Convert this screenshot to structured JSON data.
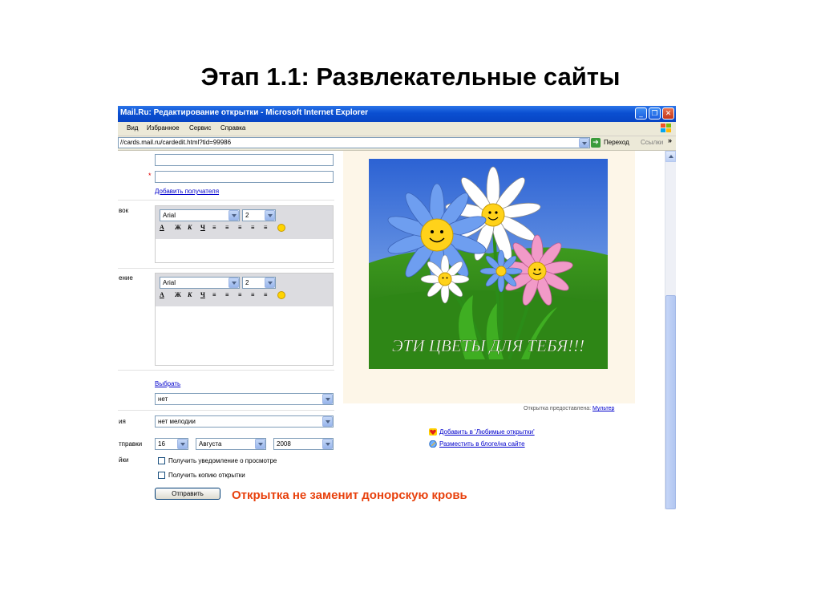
{
  "slide": {
    "title": "Этап 1.1: Развлекательные сайты",
    "caption": "Открытка не заменит донорскую кровь"
  },
  "window": {
    "title": "Mail.Ru: Редактирование открытки - Microsoft Internet Explorer",
    "menu": [
      "Вид",
      "Избранное",
      "Сервис",
      "Справка"
    ],
    "address": "//cards.mail.ru/cardedit.html?tid=99986",
    "go_label": "Переход",
    "links_label": "Ссылки",
    "chevron": "»"
  },
  "form": {
    "required_mark": "*",
    "add_recipient": "Добавить получателя",
    "editor1": {
      "label": "вок",
      "font": "Arial",
      "size": "2"
    },
    "editor2": {
      "label": "ение",
      "font": "Arial",
      "size": "2"
    },
    "toolbar_glyphs": [
      "A",
      "Ж",
      "К",
      "Ч",
      "≡",
      "≡",
      "≡",
      "≡",
      "≡"
    ],
    "choose_link": "Выбрать",
    "choose_value": "нет",
    "melody_label": "ия",
    "melody_value": "нет мелодии",
    "date_label": "тправки",
    "day": "16",
    "month": "Августа",
    "year": "2008",
    "settings_label": "йки",
    "notify_label": "Получить уведомление о просмотре",
    "copy_label": "Получить копию открытки",
    "send_button": "Отправить"
  },
  "card": {
    "greeting": "ЭТИ ЦВЕТЫ ДЛЯ ТЕБЯ!!!",
    "credit_text": "Открытка предоставлена: ",
    "credit_link": "Мультер",
    "favorites_link": "Добавить в 'Любимые открытки'",
    "blog_link": "Разместить в блоге/на сайте"
  },
  "colors": {
    "caption": "#e8410d",
    "link": "#0000cc",
    "titlebar": "#0a4fd1"
  }
}
